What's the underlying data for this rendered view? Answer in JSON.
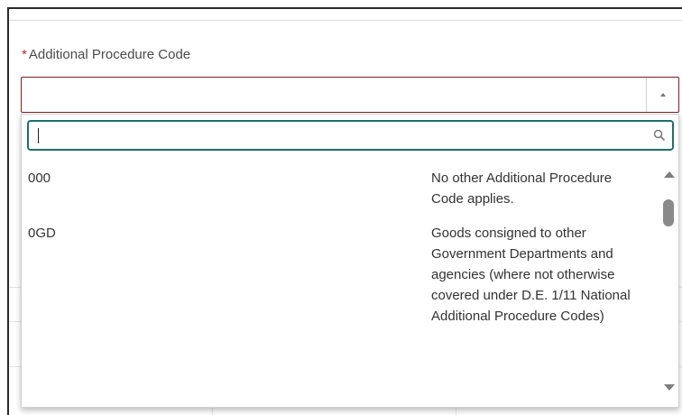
{
  "field": {
    "required_marker": "*",
    "label": "Additional Procedure Code",
    "selected_value": ""
  },
  "dropdown": {
    "search": {
      "value": "",
      "placeholder": ""
    },
    "options": [
      {
        "code": "000",
        "description": "No other Additional Procedure Code applies."
      },
      {
        "code": "0GD",
        "description": "Goods consigned to other Government Departments and agencies (where not otherwise covered under D.E. 1/11 National Additional Procedure Codes)"
      }
    ]
  },
  "icons": {
    "select_arrow": "chevron-up-icon",
    "search": "search-icon",
    "scroll_up": "scroll-up-arrow-icon",
    "scroll_down": "scroll-down-arrow-icon"
  },
  "colors": {
    "required": "#c0282f",
    "select_border": "#7a1f24",
    "search_border": "#1f6f6a"
  }
}
